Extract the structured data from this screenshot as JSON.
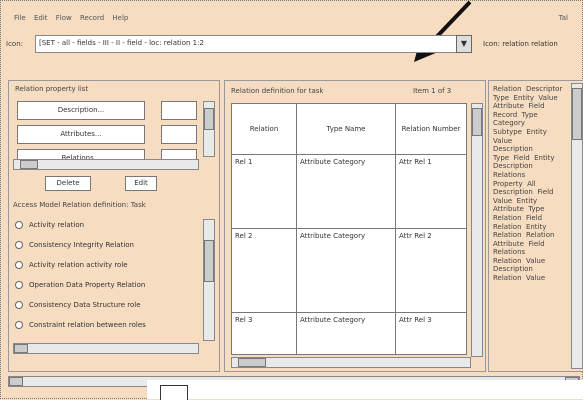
{
  "menubar": {
    "items": [
      "File",
      "Edit",
      "Flow",
      "Record",
      "Help"
    ],
    "right": "Tal"
  },
  "toolbar": {
    "label": "Icon:",
    "combo_value": "[SET - all - fields - III  - II - field  - loc: relation  1:2",
    "combo_button": "▼",
    "right_label": "Icon:  relation   relation"
  },
  "left_panel": {
    "title": "Relation  property list",
    "buttons": [
      "Description...",
      "Attributes...",
      "Relations..."
    ],
    "small_buttons": [
      "Delete",
      "Edit"
    ],
    "list_title": "Access  Model  Relation  definition: Task",
    "radios": [
      "Activity  relation",
      "Consistency  Integrity  Relation",
      "Activity  relation  activity  role",
      "Operation Data Property Relation",
      "Consistency Data  Structure role",
      "Constraint  relation  between  roles"
    ]
  },
  "middle_panel": {
    "title": "Relation  definition  for  task",
    "title_right": "Item 1 of 3",
    "headers": [
      "Relation",
      "Type  Name",
      "Relation  Number"
    ],
    "rows": [
      [
        "Rel 1",
        "Attribute  Category",
        "Attr  Rel 1"
      ],
      [
        "Rel 2",
        "Attribute  Category",
        "Attr  Rel 2"
      ],
      [
        "Rel 3",
        "Attribute  Category",
        "Attr  Rel 3"
      ]
    ]
  },
  "right_panel": {
    "text": [
      "Relation  Descriptor",
      "Type  Entity  Value",
      "Attribute  Field",
      "Record  Type",
      "Category",
      "Subtype  Entity",
      "Value",
      "Description",
      "Type  Field  Entity",
      "Description",
      "Relations",
      "Property  All",
      "Description  Field",
      "Value  Entity",
      "Attribute  Type",
      "Relation  Field",
      "Relation  Entity",
      "Relation  Relation",
      "Attribute  Field",
      "Relations",
      "Relation  Value",
      "Description",
      "Relation  Value"
    ]
  }
}
